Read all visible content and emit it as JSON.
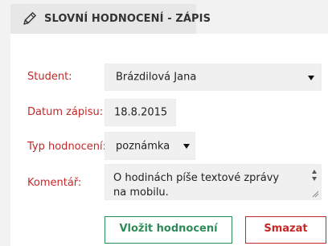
{
  "header": {
    "icon": "pencil-icon",
    "title": "SLOVNÍ HODNOCENÍ - ZÁPIS"
  },
  "form": {
    "student_label": "Student:",
    "student_value": "Brázdilová Jana",
    "date_label": "Datum zápisu:",
    "date_value": "18.8.2015",
    "type_label": "Typ hodnocení:",
    "type_value": "poznámka",
    "comment_label": "Komentář:",
    "comment_value": "O hodinách píše textové zprávy na mobilu."
  },
  "actions": {
    "submit_label": "Vložit hodnocení",
    "delete_label": "Smazat"
  },
  "colors": {
    "label": "#c62828",
    "submit": "#2e8b57",
    "delete": "#c62828"
  }
}
